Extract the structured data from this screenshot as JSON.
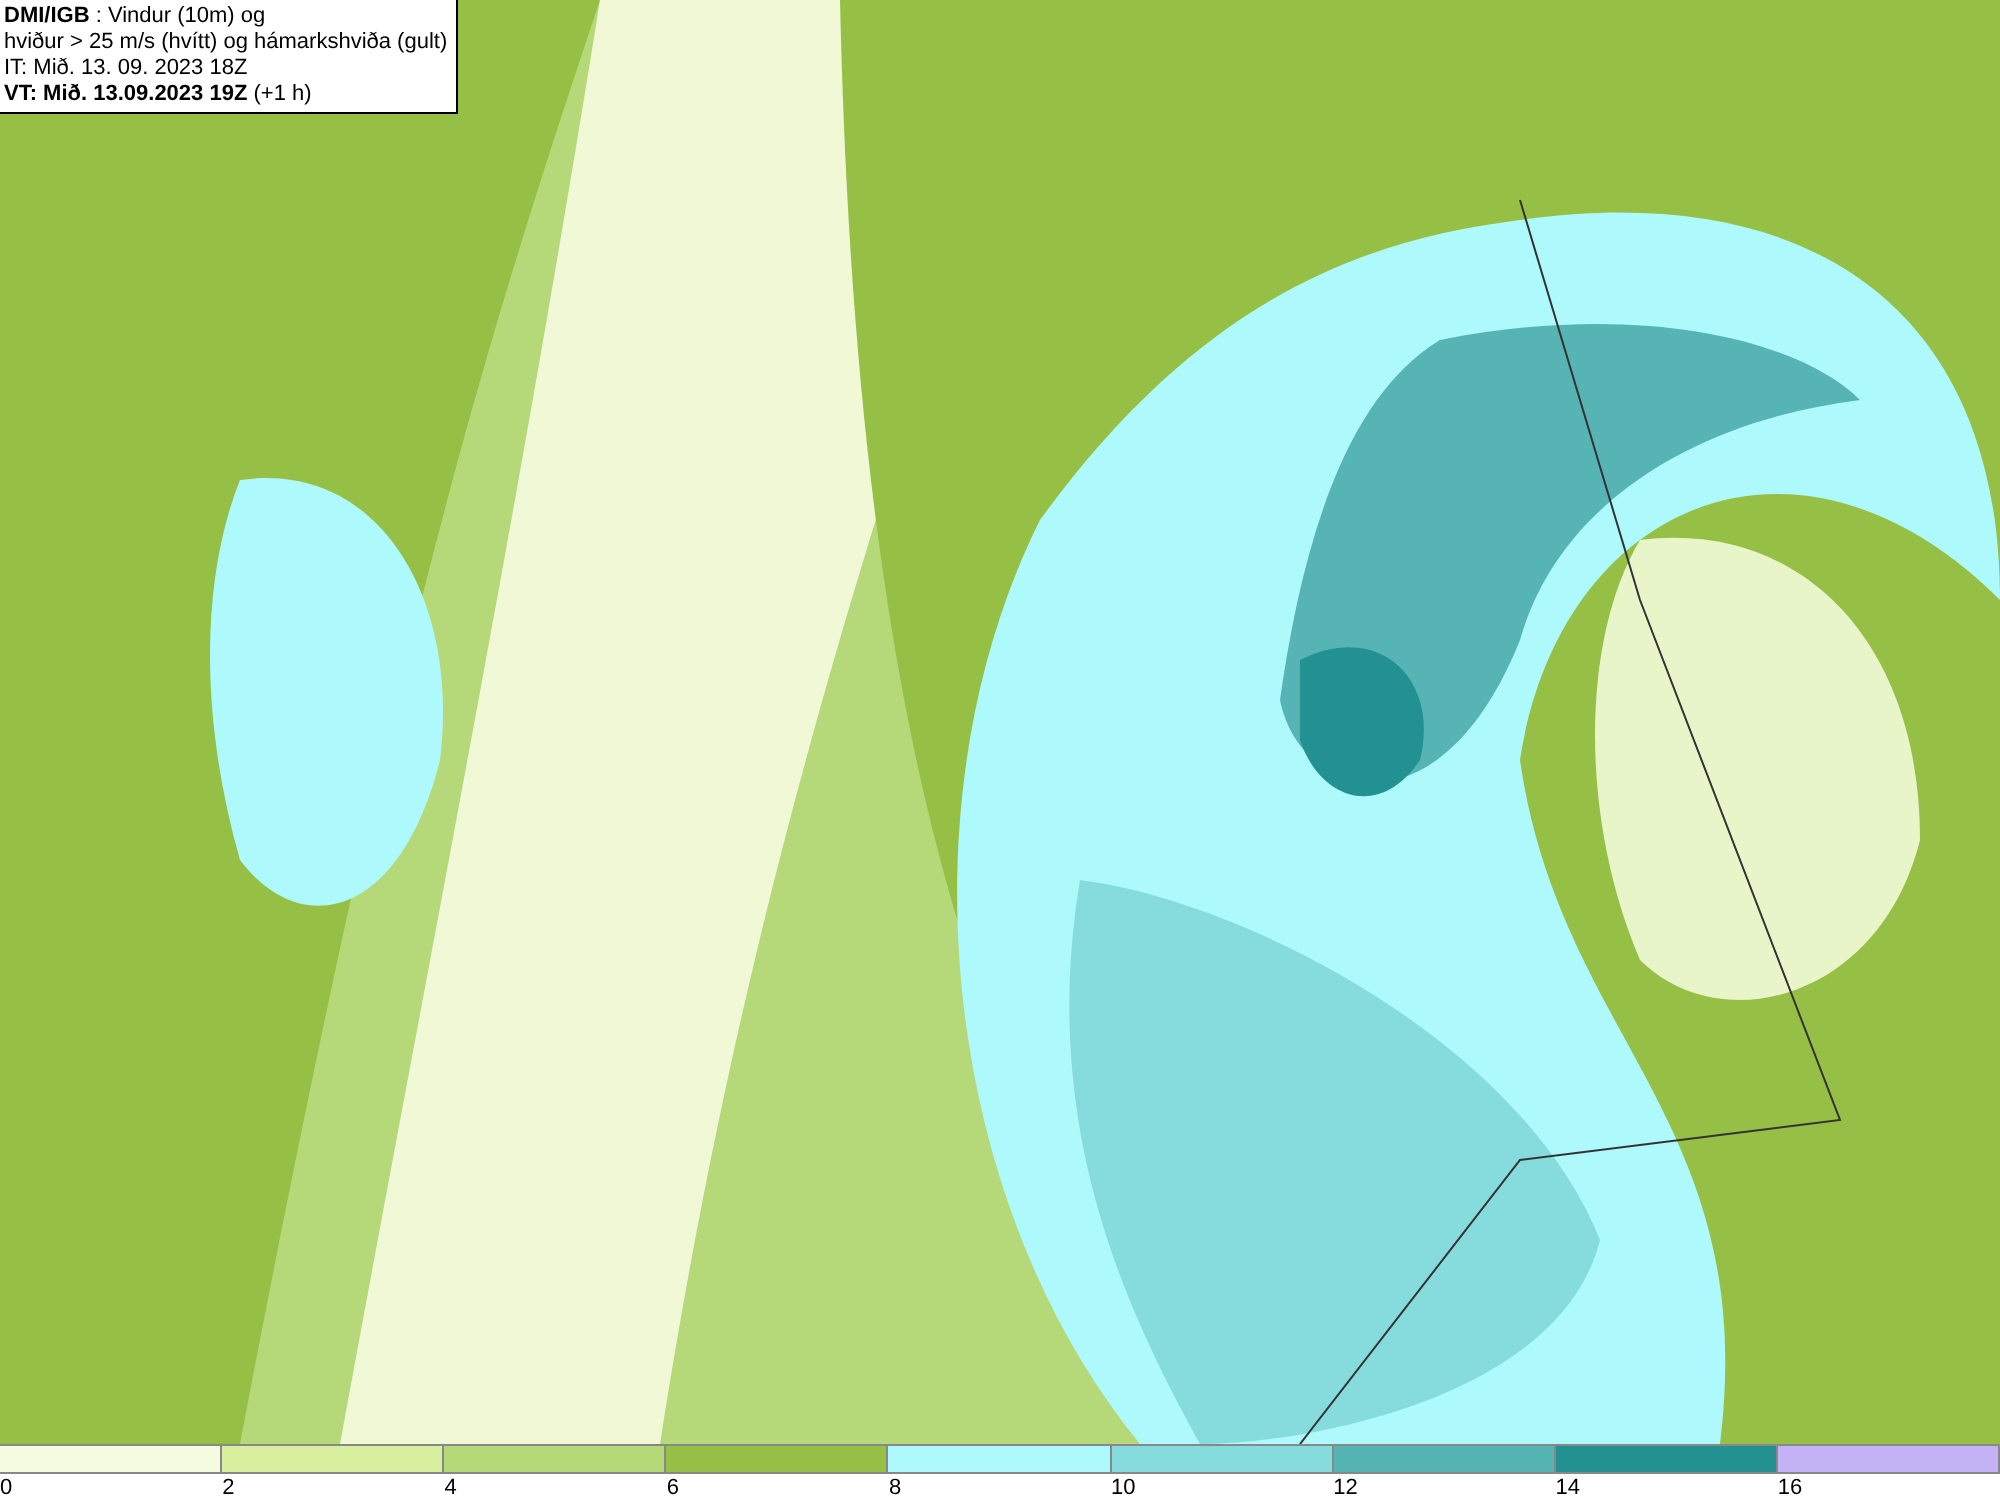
{
  "header": {
    "lines": [
      "**DMI/IGB** : Vindur (10m) og",
      "hviður > 25 m/s (hvítt) og hámarkshviða (gult)",
      "IT: Mið. 13. 09. 2023 18Z",
      "**VT: Mið. 13.09.2023 19Z** (+1 h)"
    ]
  },
  "legend": {
    "bins": [
      {
        "label": "0",
        "color": "#f5fbe0"
      },
      {
        "label": "2",
        "color": "#d8efa0"
      },
      {
        "label": "4",
        "color": "#b5d878"
      },
      {
        "label": "6",
        "color": "#96bf45"
      },
      {
        "label": "8",
        "color": "#adf9fb"
      },
      {
        "label": "10",
        "color": "#86dcdc"
      },
      {
        "label": "12",
        "color": "#57b4b4"
      },
      {
        "label": "14",
        "color": "#239191"
      },
      {
        "label": "16",
        "color": "#c4b2f7"
      }
    ]
  }
}
